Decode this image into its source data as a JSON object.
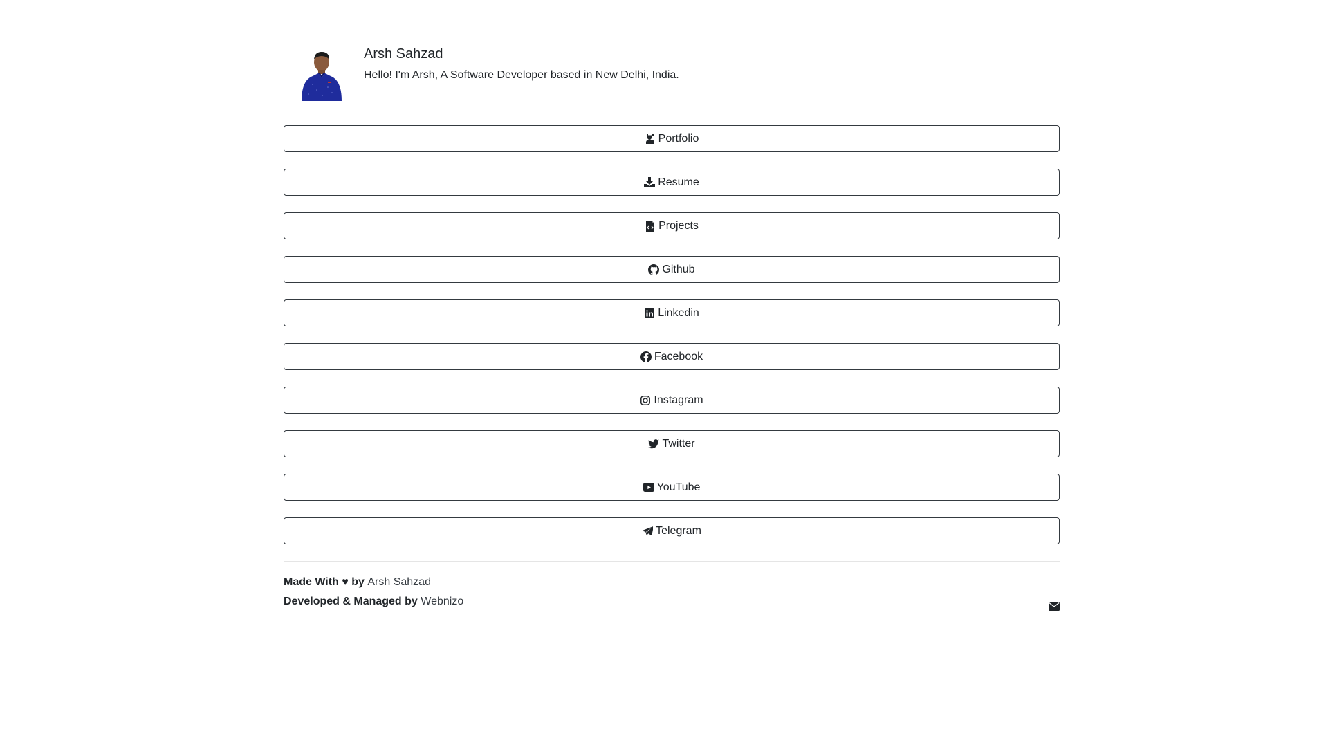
{
  "profile": {
    "name": "Arsh Sahzad",
    "bio": "Hello! I'm Arsh, A Software Developer based in New Delhi, India.",
    "avatar_icon": "avatar-photo"
  },
  "links": [
    {
      "label": "Portfolio",
      "icon": "portfolio-icon"
    },
    {
      "label": "Resume",
      "icon": "download-icon"
    },
    {
      "label": "Projects",
      "icon": "file-code-icon"
    },
    {
      "label": "Github",
      "icon": "github-icon"
    },
    {
      "label": "Linkedin",
      "icon": "linkedin-icon"
    },
    {
      "label": "Facebook",
      "icon": "facebook-icon"
    },
    {
      "label": "Instagram",
      "icon": "instagram-icon"
    },
    {
      "label": "Twitter",
      "icon": "twitter-icon"
    },
    {
      "label": "YouTube",
      "icon": "youtube-icon"
    },
    {
      "label": "Telegram",
      "icon": "telegram-icon"
    }
  ],
  "footer": {
    "made_with_prefix": "Made With ♥ by ",
    "made_with_link": "Arsh Sahzad",
    "developed_prefix": "Developed & Managed by ",
    "developed_link": "Webnizo",
    "mail_icon": "envelope-icon"
  },
  "colors": {
    "text": "#212529",
    "button_border": "#343a40",
    "divider": "#e5e5e5",
    "background": "#ffffff"
  }
}
